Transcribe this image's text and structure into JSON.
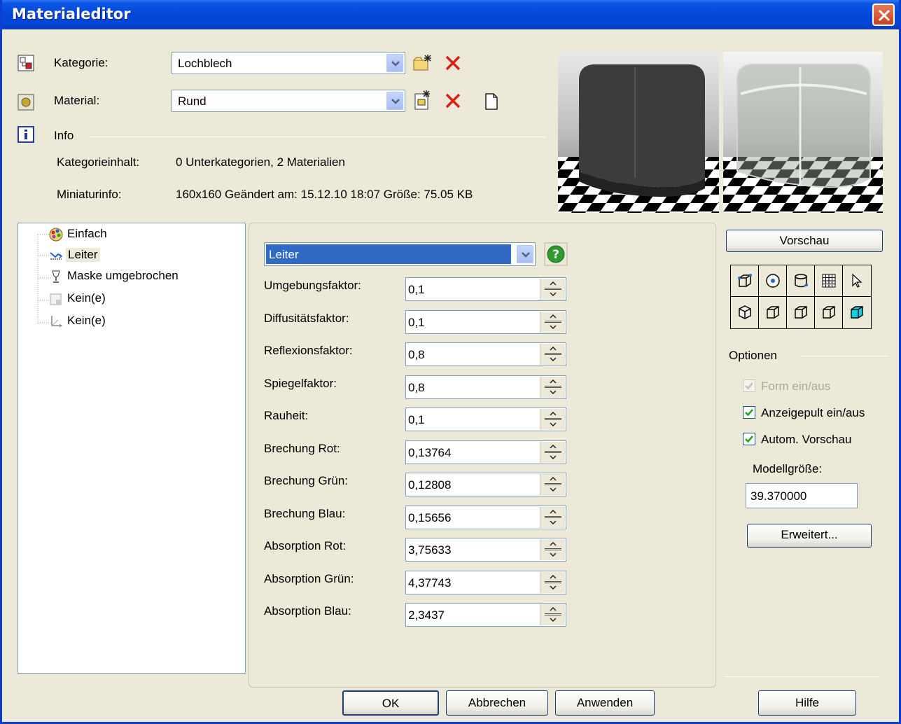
{
  "window": {
    "title": "Materialeditor"
  },
  "header": {
    "kategorie_label": "Kategorie:",
    "kategorie_value": "Lochblech",
    "material_label": "Material:",
    "material_value": "Rund",
    "info_label": "Info",
    "kategorieinhalt_label": "Kategorieinhalt:",
    "kategorieinhalt_value": "0 Unterkategorien,  2 Materialien",
    "miniaturinfo_label": "Miniaturinfo:",
    "miniaturinfo_value": "160x160  Geändert am: 15.12.10 18:07 Größe: 75.05  KB"
  },
  "tree": {
    "items": [
      {
        "label": "Einfach",
        "icon": "palette-icon"
      },
      {
        "label": "Leiter",
        "icon": "conductor-icon",
        "selected": true
      },
      {
        "label": "Maske umgebrochen",
        "icon": "goblet-icon"
      },
      {
        "label": "Kein(e)",
        "icon": "blank-map-icon"
      },
      {
        "label": "Kein(e)",
        "icon": "axis-icon"
      }
    ]
  },
  "props": {
    "type_value": "Leiter",
    "fields": [
      {
        "label": "Umgebungsfaktor:",
        "value": "0,1"
      },
      {
        "label": "Diffusitätsfaktor:",
        "value": "0,1"
      },
      {
        "label": "Reflexionsfaktor:",
        "value": "0,8"
      },
      {
        "label": "Spiegelfaktor:",
        "value": "0,8"
      },
      {
        "label": "Rauheit:",
        "value": "0,1"
      },
      {
        "label": "Brechung Rot:",
        "value": "0,13764"
      },
      {
        "label": "Brechung Grün:",
        "value": "0,12808"
      },
      {
        "label": "Brechung Blau:",
        "value": "0,15656"
      },
      {
        "label": "Absorption Rot:",
        "value": "3,75633"
      },
      {
        "label": "Absorption Grün:",
        "value": "4,37743"
      },
      {
        "label": "Absorption Blau:",
        "value": "2,3437"
      }
    ]
  },
  "right": {
    "vorschau_label": "Vorschau",
    "optionen_label": "Optionen",
    "form_label": "Form ein/aus",
    "anzeigepult_label": "Anzeigepult ein/aus",
    "autom_label": "Autom. Vorschau",
    "modellgroesse_label": "Modellgröße:",
    "modellgroesse_value": "39.370000",
    "erweitert_label": "Erweitert..."
  },
  "footer": {
    "ok_label": "OK",
    "abbrechen_label": "Abbrechen",
    "anwenden_label": "Anwenden",
    "hilfe_label": "Hilfe"
  },
  "colors": {
    "title_bar": "#0447d8",
    "selection": "#316ac5",
    "help_green": "#2f9a2f"
  }
}
